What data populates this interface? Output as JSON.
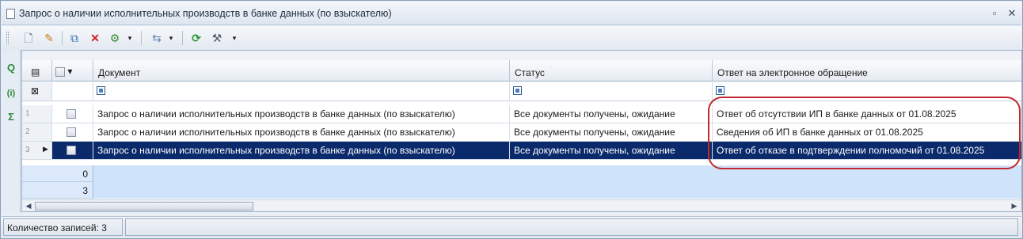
{
  "window": {
    "title": "Запрос о наличии исполнительных производств в банке данных (по взыскателю)",
    "pin_icon": "pin-icon",
    "close_glyph": "✕"
  },
  "toolbar": {
    "buttons": [
      "new-doc-icon",
      "edit-doc-icon",
      "copy-icon",
      "delete-icon",
      "tools-dropdown-icon",
      "link-dropdown-icon",
      "refresh-icon",
      "settings-dropdown-icon"
    ]
  },
  "leftbar": {
    "search_glyph": "Q",
    "info_glyph": "(i)",
    "sum_glyph": "Σ"
  },
  "grid": {
    "columns": {
      "document": "Документ",
      "status": "Статус",
      "response": "Ответ на электронное обращение"
    },
    "rows": [
      {
        "num": "1",
        "document": "Запрос о наличии исполнительных производств в банке данных (по взыскателю)",
        "status": "Все документы получены, ожидание",
        "response": "Ответ об отсутствии ИП в банке данных от 01.08.2025"
      },
      {
        "num": "2",
        "document": "Запрос о наличии исполнительных производств в банке данных (по взыскателю)",
        "status": "Все документы получены, ожидание",
        "response": "Сведения об ИП в банке данных от 01.08.2025"
      },
      {
        "num": "3",
        "document": "Запрос о наличии исполнительных производств в банке данных (по взыскателю)",
        "status": "Все документы получены, ожидание",
        "response": "Ответ об отказе в подтверждении полномочий от 01.08.2025",
        "selected": true
      }
    ],
    "footer": [
      "0",
      "3"
    ]
  },
  "status_bar": {
    "records": "Количество записей: 3"
  },
  "colors": {
    "selection": "#0b2a6b",
    "highlight": "#c0282d",
    "footer": "#cfe3fb"
  }
}
